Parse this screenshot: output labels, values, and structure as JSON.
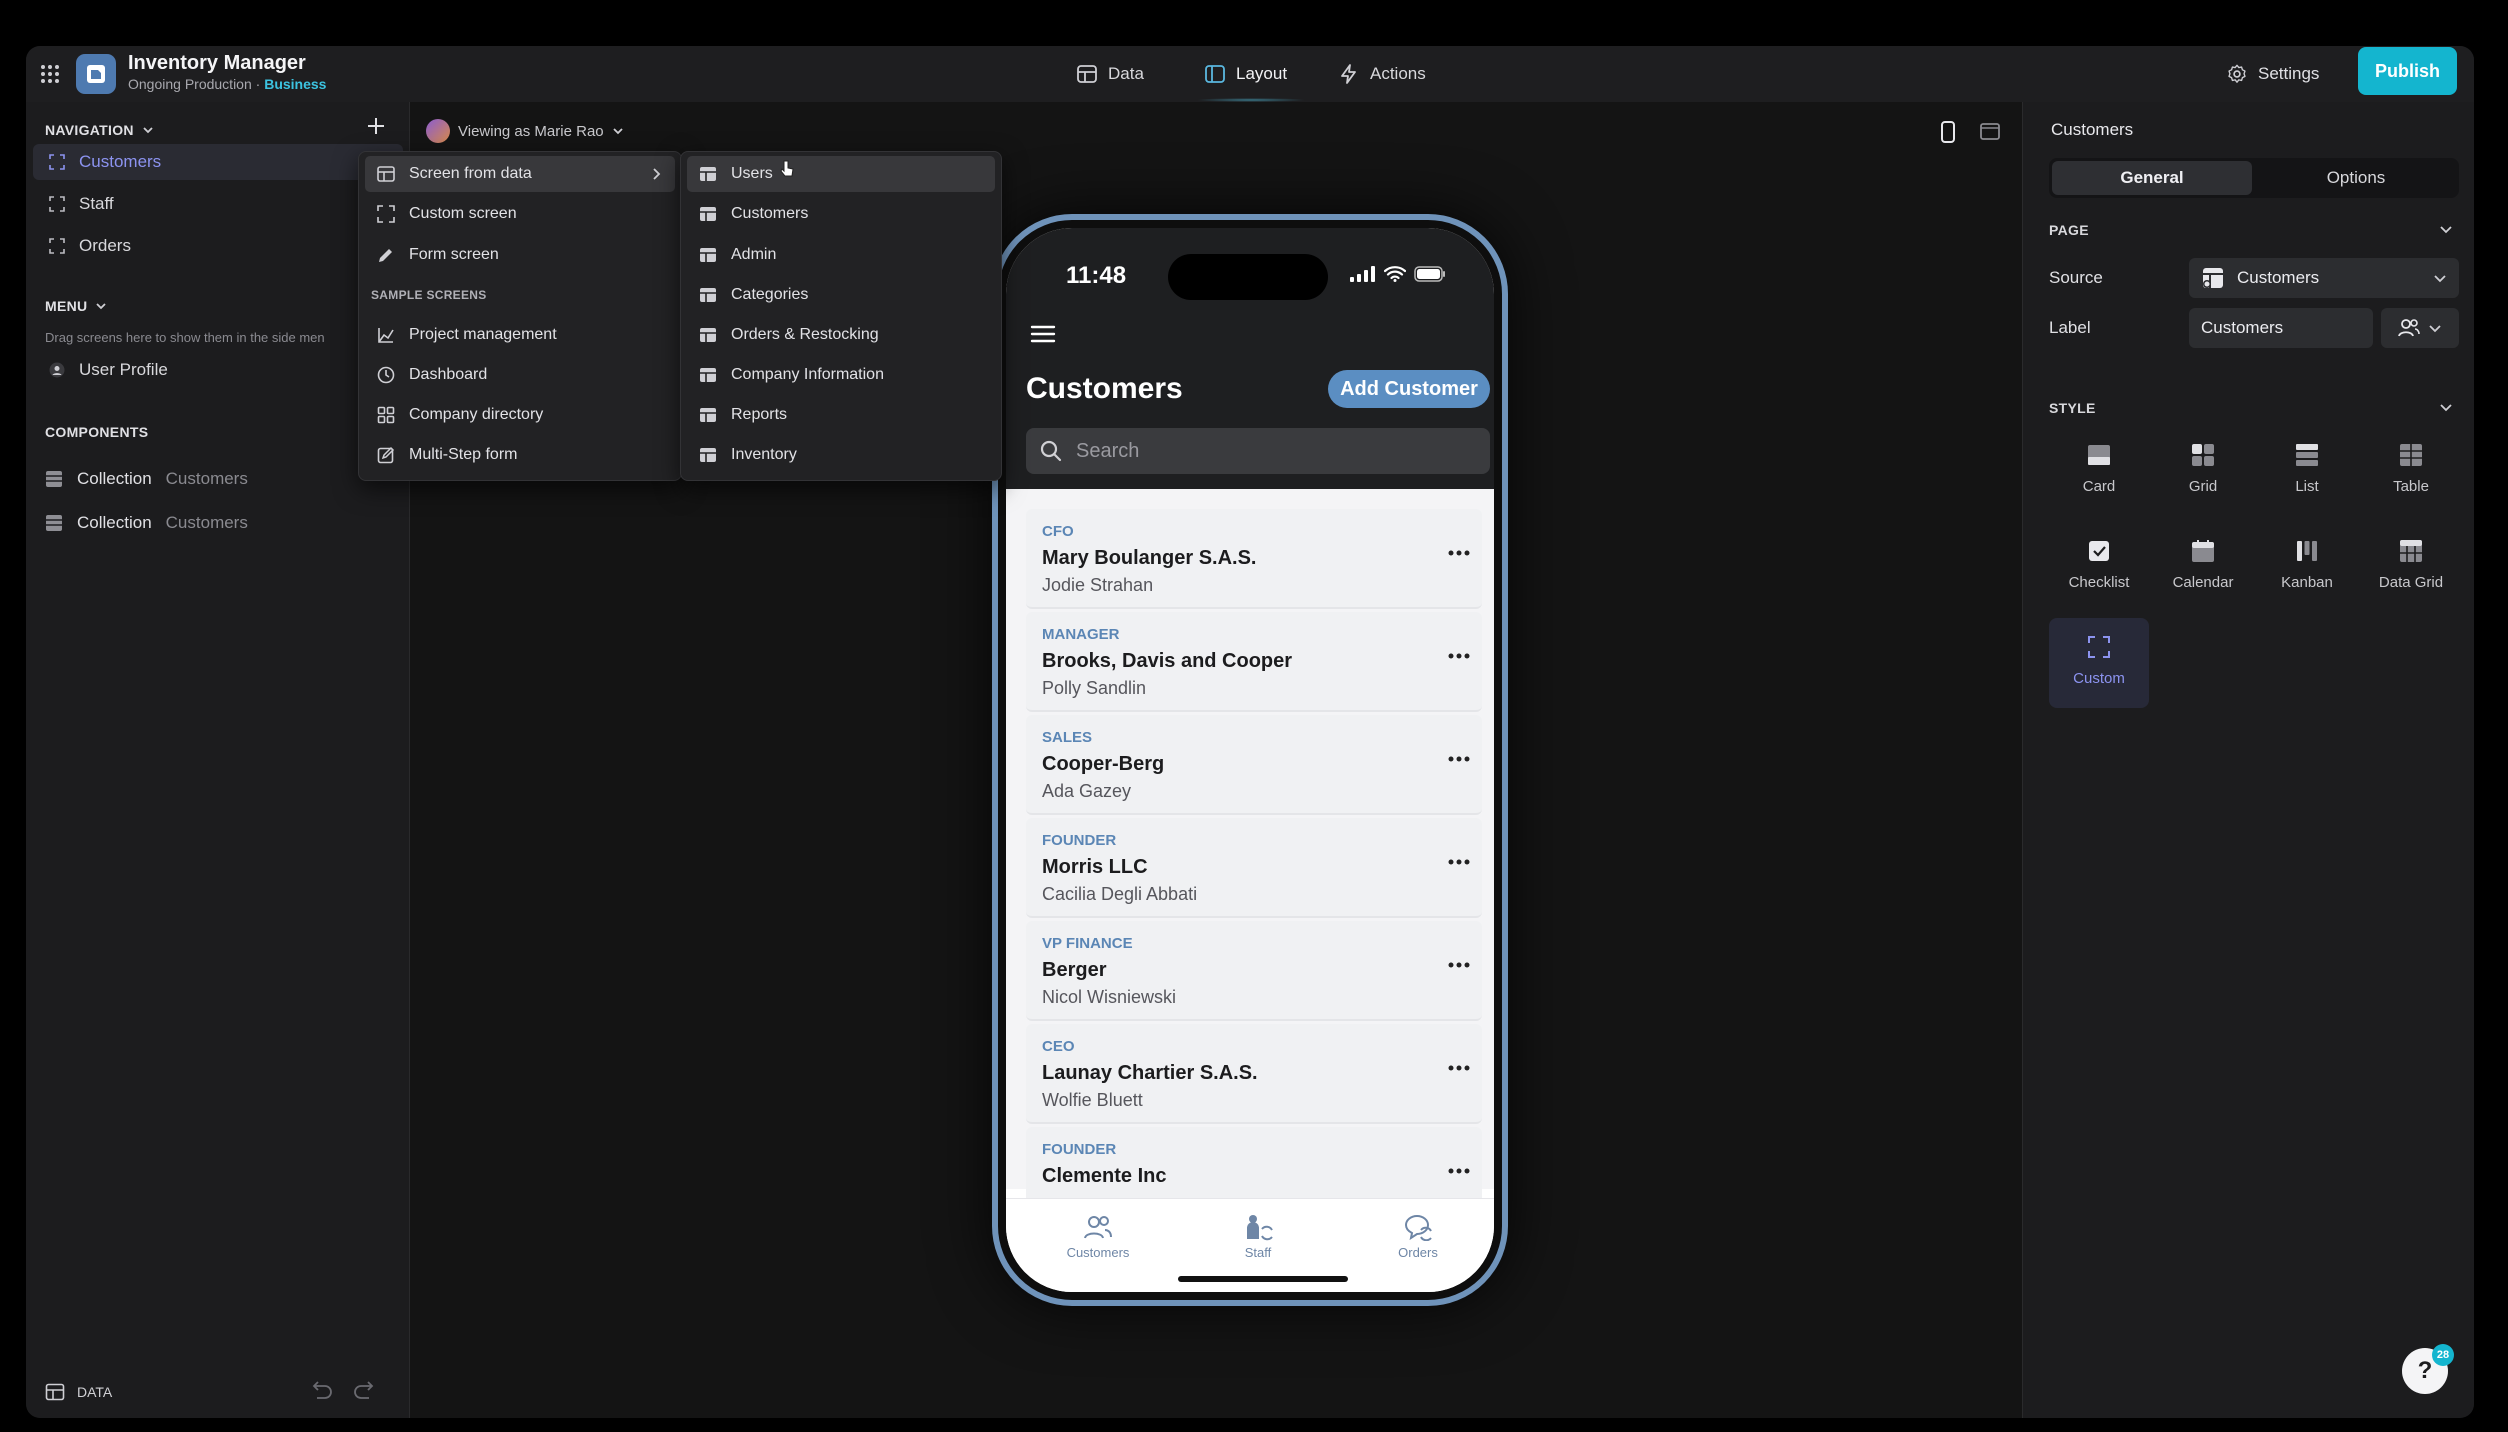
{
  "app": {
    "name": "Inventory Manager",
    "subtitle": "Ongoing Production · ",
    "plan": "Business"
  },
  "top_tabs": [
    {
      "label": "Data",
      "icon": "table-icon"
    },
    {
      "label": "Layout",
      "icon": "layout-icon",
      "active": true
    },
    {
      "label": "Actions",
      "icon": "bolt-icon"
    }
  ],
  "top_right": {
    "settings": "Settings",
    "publish": "Publish"
  },
  "sidebar": {
    "navigation_label": "NAVIGATION",
    "nav_items": [
      {
        "label": "Customers",
        "active": true
      },
      {
        "label": "Staff"
      },
      {
        "label": "Orders"
      }
    ],
    "menu_label": "MENU",
    "menu_hint": "Drag screens here to show them in the side men",
    "menu_items": [
      {
        "label": "User Profile"
      }
    ],
    "components_label": "COMPONENTS",
    "components": [
      {
        "type": "Collection",
        "source": "Customers"
      },
      {
        "type": "Collection",
        "source": "Customers"
      }
    ],
    "footer_label": "DATA"
  },
  "canvas": {
    "viewing_as": "Viewing as Marie Rao"
  },
  "add_menu": {
    "items": [
      {
        "label": "Screen from data",
        "icon": "table-icon",
        "highlighted": true
      },
      {
        "label": "Custom screen",
        "icon": "expand-icon"
      },
      {
        "label": "Form screen",
        "icon": "pencil-icon"
      }
    ],
    "sample_label": "SAMPLE SCREENS",
    "samples": [
      {
        "label": "Project management",
        "icon": "chart-icon"
      },
      {
        "label": "Dashboard",
        "icon": "clock-icon"
      },
      {
        "label": "Company directory",
        "icon": "grid-icon"
      },
      {
        "label": "Multi-Step form",
        "icon": "edit-icon"
      }
    ]
  },
  "data_menu": {
    "items": [
      {
        "label": "Users",
        "highlighted": true
      },
      {
        "label": "Customers"
      },
      {
        "label": "Admin"
      },
      {
        "label": "Categories"
      },
      {
        "label": "Orders & Restocking"
      },
      {
        "label": "Company Information"
      },
      {
        "label": "Reports"
      },
      {
        "label": "Inventory"
      }
    ]
  },
  "phone": {
    "time": "11:48",
    "title": "Customers",
    "add_button": "Add Customer",
    "search_placeholder": "Search",
    "list": [
      {
        "role": "CFO",
        "name": "Mary Boulanger S.A.S.",
        "person": "Jodie Strahan"
      },
      {
        "role": "MANAGER",
        "name": "Brooks, Davis and Cooper",
        "person": "Polly Sandlin"
      },
      {
        "role": "SALES",
        "name": "Cooper-Berg",
        "person": "Ada Gazey"
      },
      {
        "role": "FOUNDER",
        "name": "Morris LLC",
        "person": "Cacilia Degli Abbati"
      },
      {
        "role": "VP FINANCE",
        "name": "Berger",
        "person": "Nicol Wisniewski"
      },
      {
        "role": "CEO",
        "name": "Launay Chartier S.A.S.",
        "person": "Wolfie Bluett"
      },
      {
        "role": "FOUNDER",
        "name": "Clemente Inc",
        "person": ""
      }
    ],
    "tabs": [
      {
        "label": "Customers",
        "icon": "users-icon"
      },
      {
        "label": "Staff",
        "icon": "staff-icon"
      },
      {
        "label": "Orders",
        "icon": "orders-icon"
      }
    ]
  },
  "right_panel": {
    "title": "Customers",
    "tabs": [
      {
        "label": "General",
        "active": true
      },
      {
        "label": "Options"
      }
    ],
    "page_label": "PAGE",
    "source_label": "Source",
    "source_value": "Customers",
    "label_label": "Label",
    "label_value": "Customers",
    "style_label": "STYLE",
    "styles": [
      {
        "label": "Card"
      },
      {
        "label": "Grid"
      },
      {
        "label": "List"
      },
      {
        "label": "Table"
      },
      {
        "label": "Checklist"
      },
      {
        "label": "Calendar"
      },
      {
        "label": "Kanban"
      },
      {
        "label": "Data Grid"
      },
      {
        "label": "Custom",
        "active": true
      }
    ]
  },
  "help": {
    "label": "?",
    "badge": "28"
  },
  "colors": {
    "accent": "#14b5cf",
    "active_nav": "#8c93f0",
    "phone_frame": "#6f93ba",
    "phone_button": "#5b8ec2"
  }
}
